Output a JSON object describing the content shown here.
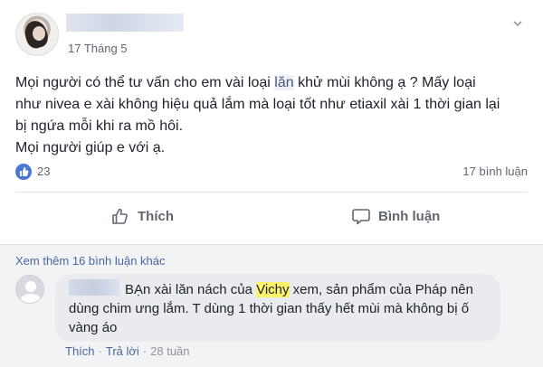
{
  "post": {
    "timestamp": "17 Tháng 5",
    "lines": [
      "Mọi người có thể tư vấn cho em vài loại ",
      "lăn",
      " khử mùi không ạ ? Mấy loại",
      "như nivea e xài không hiệu quả lắm mà loại tốt như etiaxil xài 1 thời gian lại",
      "bị ngứa mỗi khi ra mồ hôi.",
      "Mọi người giúp e với ạ."
    ],
    "likes": "23",
    "comments_count": "17 bình luận"
  },
  "actions": {
    "like_label": "Thích",
    "comment_label": "Bình luận"
  },
  "comments": {
    "view_more": "Xem thêm 16 bình luận khác",
    "item": {
      "text_before": "BẠn xài lăn nách của ",
      "highlight": "Vichy",
      "text_after": " xem, sản phẩm của Pháp nên dùng chim ưng lắm. T dùng 1 thời gian thấy hết mùi mà không bị ố vàng áo",
      "like_label": "Thích",
      "separator": "·",
      "reply_label": "Trả lời",
      "age": "28 tuần"
    }
  },
  "icons": {
    "like_badge": "thumbs-up-icon",
    "menu": "chevron-down-icon",
    "like_button": "thumbs-up-outline-icon",
    "comment_button": "speech-bubble-icon"
  },
  "colors": {
    "link": "#4b67a1",
    "like_badge": "#4a76d4",
    "highlight": "#fff36b"
  }
}
